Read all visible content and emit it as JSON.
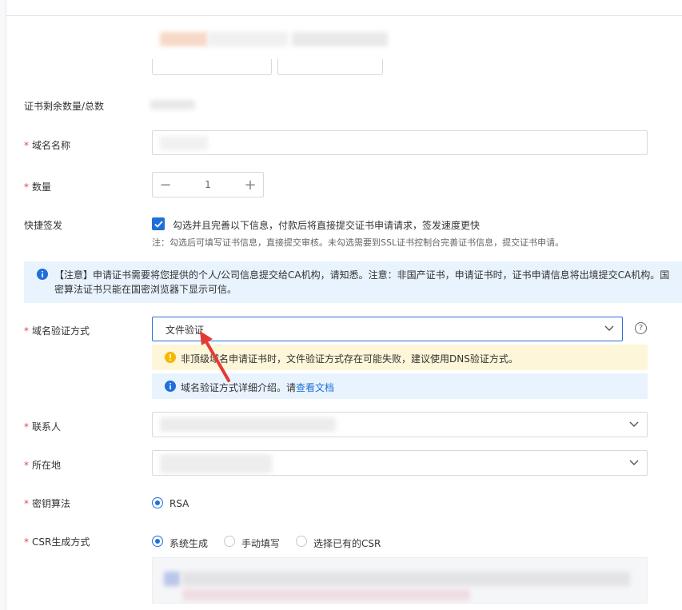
{
  "form": {
    "cert_count_label": "证书剩余数量/总数",
    "domain_label": "域名名称",
    "quantity_label": "数量",
    "quantity_value": "1",
    "stepper_minus": "−",
    "stepper_plus": "+",
    "quick_sign_label": "快捷签发",
    "quick_sign_checkbox_text": "勾选并且完善以下信息，付款后将直接提交证书申请请求，签发速度更快",
    "quick_sign_note": "注：勾选后可填写证书信息，直接提交审核。未勾选需要到SSL证书控制台完善证书信息，提交证书申请。",
    "notice_text": "【注意】申请证书需要将您提供的个人/公司信息提交给CA机构，请知悉。注意：非国产证书，申请证书时，证书申请信息将出境提交CA机构。国密算法证书只能在国密浏览器下显示可信。",
    "verify_method_label": "域名验证方式",
    "verify_method_value": "文件验证",
    "help_glyph": "?",
    "warn_text": "非顶级域名申请证书时，文件验证方式存在可能失败，建议使用DNS验证方式。",
    "info_text": "域名验证方式详细介绍。请",
    "info_link": "查看文档",
    "contact_label": "联系人",
    "location_label": "所在地",
    "key_algo_label": "密钥算法",
    "key_algo_option": "RSA",
    "csr_label": "CSR生成方式",
    "csr_options": [
      "系统生成",
      "手动填写",
      "选择已有的CSR"
    ],
    "required_mark": "*"
  },
  "colors": {
    "primary": "#1f6fdb",
    "required": "#e5484d",
    "notice_bg": "#e8f3fd",
    "warn_bg": "#fdf6d8",
    "warn_icon": "#f5b800",
    "arrow": "#e53935"
  },
  "icons": [
    "info-icon",
    "warning-icon",
    "chevron-down-icon",
    "help-icon",
    "check-icon"
  ]
}
